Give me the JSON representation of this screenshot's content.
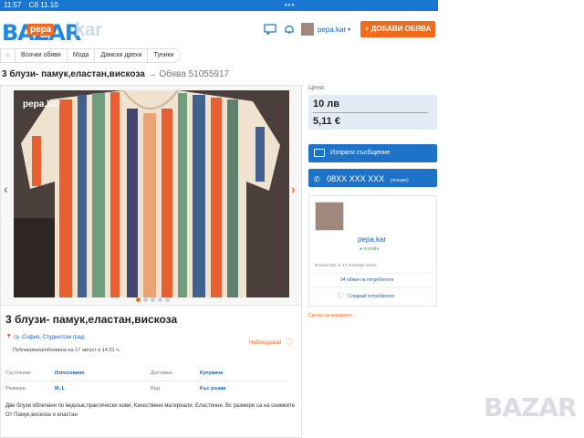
{
  "status_bar": {
    "time": "11:57",
    "date": "Сб 11.10",
    "dots": "•••"
  },
  "header": {
    "logo_text": "BAZAR",
    "logo_badge": "pepa",
    "logo_ghost": "kar",
    "username": "pepa.kar",
    "add_button": "+ ДОБАВИ ОБЯВА"
  },
  "breadcrumbs": [
    "Всички обяви",
    "Мода",
    "Дамски дрехи",
    "Туники"
  ],
  "title_row": {
    "title": "3 блузи- памук,еластан,вискоза",
    "arrow": "→",
    "ad_id": "Обява 51055917"
  },
  "gallery": {
    "watermark": "pepa.kar",
    "prev": "‹",
    "next": "›",
    "dot_count": 5,
    "active_dot": 0
  },
  "ad": {
    "title": "3 блузи- памук,еластан,вискоза",
    "location": "гр. София, Студентски град",
    "published": "Публикувана/обновена на 17 август в 14:31 ч.",
    "favorite": "Наблюдавай",
    "props": [
      {
        "k1": "Състояние",
        "v1": "Използвано",
        "k2": "Доставка",
        "v2": "Купувача"
      },
      {
        "k1": "Размери",
        "v1": "M, L",
        "k2": "Вид",
        "v2": "Къс ръкав"
      }
    ],
    "description": [
      "Две блузи облечани по веднъж,практически нови. Качествени материали. Еластични. Вс размери са на снимките",
      "От Памук,вискоза и еластан"
    ]
  },
  "side": {
    "price_label": "Цена:",
    "price_bgn": "10 лв",
    "price_eur": "5,11 €",
    "message_button": "Изпрати съобщение",
    "phone": "08XX XXX XXX",
    "phone_show": "(покажи)",
    "seller": {
      "name": "pepa.kar",
      "status": "● онлайн",
      "since": "В Bazar.BG от 17 ноември 2015г.",
      "ads_count": "94 обяви на потребителя",
      "follow": "Следвай потребителя"
    },
    "report": "Сигнал за нередност"
  },
  "corner_logo": "BAZAR",
  "colors": {
    "brand_blue": "#1e73c8",
    "brand_orange": "#f26a1b",
    "price_bg": "#e3ecf5"
  }
}
